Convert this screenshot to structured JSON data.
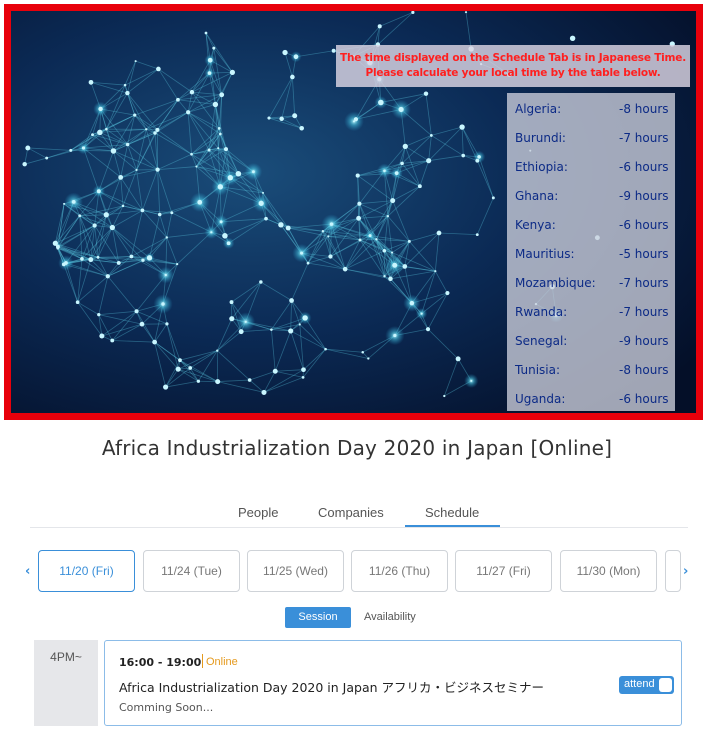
{
  "banner": {
    "notice_line1": "The time displayed on the Schedule Tab is in Japanese Time.",
    "notice_line2": "Please calculate your local time by the table below.",
    "timezones": [
      {
        "country": "Algeria:",
        "offset": "-8 hours"
      },
      {
        "country": "Burundi:",
        "offset": "-7 hours"
      },
      {
        "country": "Ethiopia:",
        "offset": "-6 hours"
      },
      {
        "country": "Ghana:",
        "offset": "-9 hours"
      },
      {
        "country": "Kenya:",
        "offset": "-6 hours"
      },
      {
        "country": "Mauritius:",
        "offset": "-5 hours"
      },
      {
        "country": "Mozambique:",
        "offset": "-7 hours"
      },
      {
        "country": "Rwanda:",
        "offset": "-7 hours"
      },
      {
        "country": "Senegal:",
        "offset": "-9 hours"
      },
      {
        "country": "Tunisia:",
        "offset": "-8 hours"
      },
      {
        "country": "Uganda:",
        "offset": "-6 hours"
      }
    ]
  },
  "page": {
    "title": "Africa Industrialization Day 2020 in Japan [Online]"
  },
  "tabs": {
    "people": "People",
    "companies": "Companies",
    "schedule": "Schedule",
    "active": "schedule"
  },
  "nav": {
    "prev_icon": "chevron-left-icon",
    "next_icon": "chevron-right-icon"
  },
  "dates": [
    {
      "label": "11/20 (Fri)",
      "active": true
    },
    {
      "label": "11/24 (Tue)",
      "active": false
    },
    {
      "label": "11/25 (Wed)",
      "active": false
    },
    {
      "label": "11/26 (Thu)",
      "active": false
    },
    {
      "label": "11/27 (Fri)",
      "active": false
    },
    {
      "label": "11/30 (Mon)",
      "active": false
    }
  ],
  "view_toggle": {
    "session": "Session",
    "availability": "Availability",
    "active": "session"
  },
  "slot": {
    "time_label": "4PM~",
    "session": {
      "time": "16:00 - 19:00",
      "mode": "Online",
      "title": "Africa Industrialization Day 2020 in Japan アフリカ・ビジネスセミナー",
      "note": "Comming Soon...",
      "attend_label": "attend",
      "attend_on": false
    }
  },
  "colors": {
    "accent": "#3a8fd9",
    "banner_border": "#e8000b",
    "notice_text": "#ff1f1f",
    "online_tag": "#e59a1e"
  }
}
